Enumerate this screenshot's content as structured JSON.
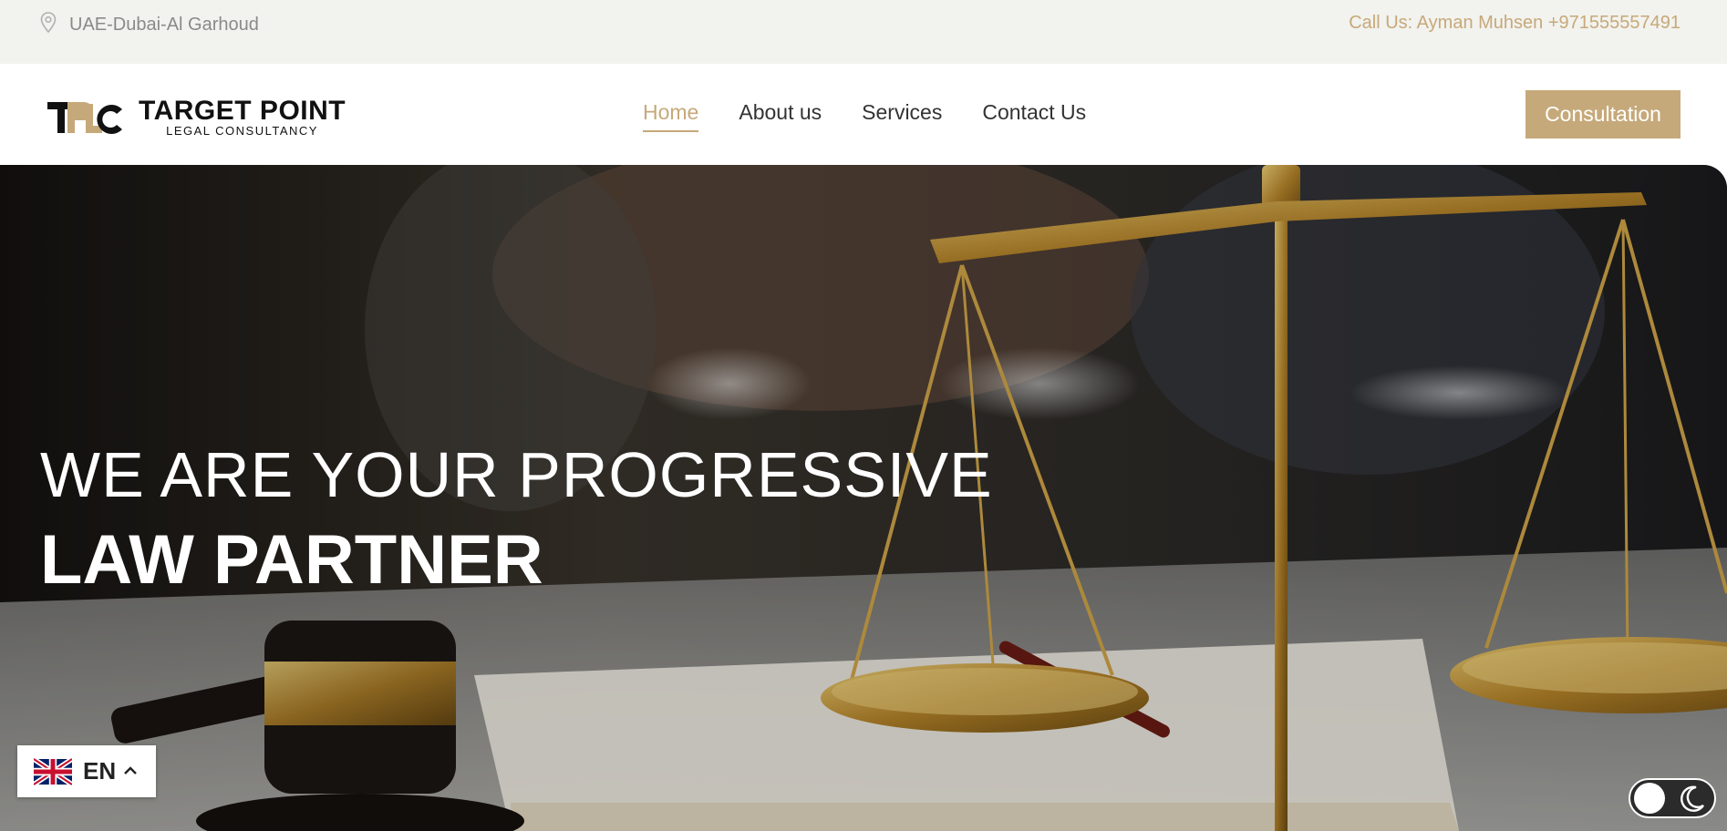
{
  "topbar": {
    "location_icon": "map-pin-icon",
    "location": "UAE-Dubai-Al Garhoud",
    "call": "Call Us: Ayman Muhsen +971555557491"
  },
  "header": {
    "logo_mark": "TPLC",
    "logo_title": "TARGET POINT",
    "logo_subtitle": "LEGAL CONSULTANCY",
    "nav": [
      {
        "label": "Home",
        "active": true
      },
      {
        "label": "About us"
      },
      {
        "label": "Services"
      },
      {
        "label": "Contact Us"
      }
    ],
    "cta_label": "Consultation"
  },
  "hero": {
    "line1": "WE ARE YOUR PROGRESSIVE",
    "line2": "LAW PARTNER"
  },
  "language": {
    "flag_icon": "uk-flag-icon",
    "code": "EN",
    "chevron_icon": "chevron-up-icon"
  },
  "theme_toggle": {
    "icon": "moon-icon"
  },
  "colors": {
    "accent": "#c6a97a",
    "topbar_bg": "#f2f2ee",
    "text_dark": "#333333"
  }
}
